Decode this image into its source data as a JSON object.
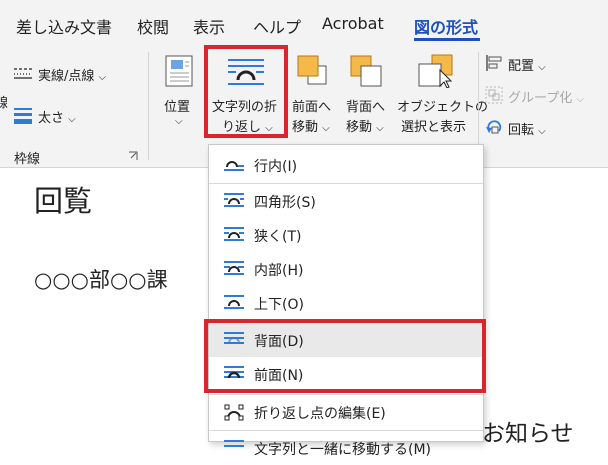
{
  "tabs": [
    "差し込み文書",
    "校閲",
    "表示",
    "ヘルプ",
    "Acrobat",
    "図の形式"
  ],
  "ribbon": {
    "line_style_label": "実線/点線",
    "weight_label": "太さ",
    "border_group_label": "枠線",
    "position_label": "位置",
    "wrap_text_label_line1": "文字列の折",
    "wrap_text_label_line2": "り返し",
    "bring_forward_line1": "前面へ",
    "bring_forward_line2": "移動",
    "send_backward_line1": "背面へ",
    "send_backward_line2": "移動",
    "selection_pane_line1": "オブジェクトの",
    "selection_pane_line2": "選択と表示",
    "align_label": "配置",
    "group_label": "グループ化",
    "rotate_label": "回転",
    "cut_left_glyph": "線"
  },
  "document": {
    "title": "回覧",
    "line1": "○○○部○○課",
    "notice": "お知らせ"
  },
  "wrap_menu": {
    "items": [
      {
        "label": "行内(I)",
        "icon": "inline-wrap-icon"
      },
      {
        "label": "四角形(S)",
        "icon": "square-wrap-icon"
      },
      {
        "label": "狭く(T)",
        "icon": "tight-wrap-icon"
      },
      {
        "label": "内部(H)",
        "icon": "through-wrap-icon"
      },
      {
        "label": "上下(O)",
        "icon": "top-bottom-wrap-icon"
      },
      {
        "label": "背面(D)",
        "icon": "behind-text-icon"
      },
      {
        "label": "前面(N)",
        "icon": "in-front-text-icon"
      },
      {
        "label": "折り返し点の編集(E)",
        "icon": "edit-wrap-points-icon"
      },
      {
        "label": "文字列と一緒に移動する(M)",
        "icon": "move-with-text-icon"
      }
    ]
  },
  "colors": {
    "accent": "#1e4fbf",
    "highlight": "#d8262d",
    "icon_blue": "#2e7cd6",
    "orange": "#f5b94a"
  }
}
